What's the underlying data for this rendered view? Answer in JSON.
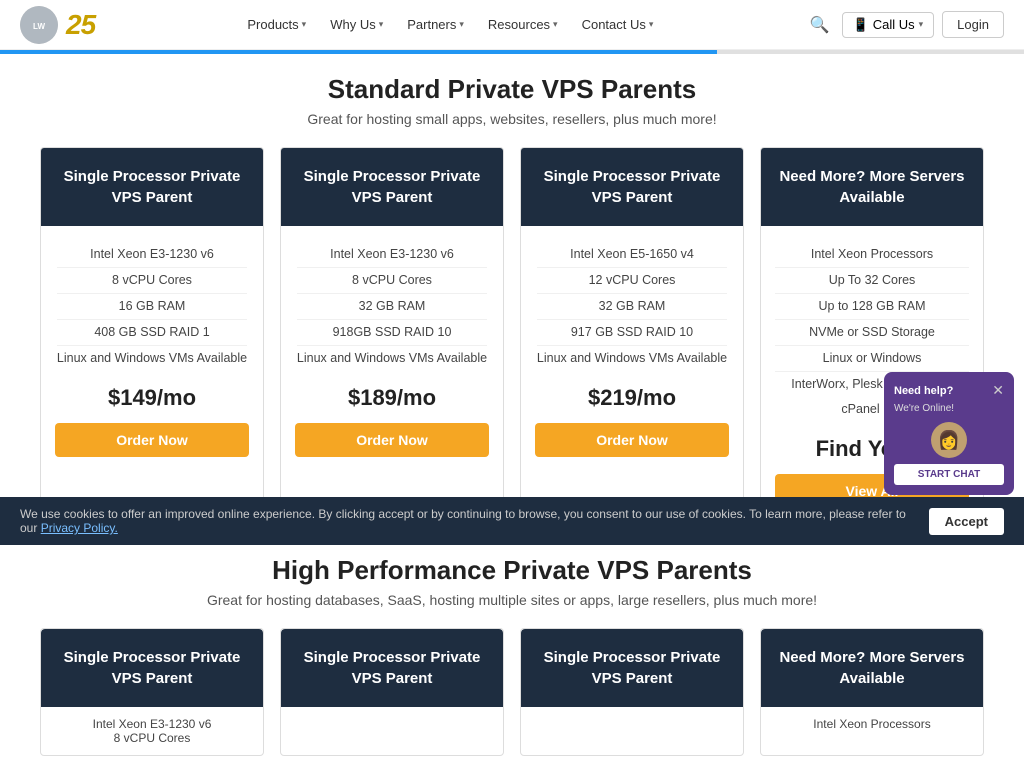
{
  "nav": {
    "logo_text": "25",
    "links": [
      {
        "label": "Products",
        "has_chevron": true
      },
      {
        "label": "Why Us",
        "has_chevron": true
      },
      {
        "label": "Partners",
        "has_chevron": true
      },
      {
        "label": "Resources",
        "has_chevron": true
      },
      {
        "label": "Contact Us",
        "has_chevron": true
      }
    ],
    "call_label": "Call Us",
    "login_label": "Login"
  },
  "standard_section": {
    "title": "Standard Private VPS Parents",
    "subtitle": "Great for hosting small apps, websites, resellers, plus much more!",
    "cards": [
      {
        "header": "Single Processor Private VPS Parent",
        "specs": [
          "Intel Xeon E3-1230 v6",
          "8 vCPU Cores",
          "16 GB RAM",
          "408 GB SSD RAID 1",
          "Linux and Windows VMs Available"
        ],
        "price": "$149/mo",
        "btn_label": "Order Now"
      },
      {
        "header": "Single Processor Private VPS Parent",
        "specs": [
          "Intel Xeon E3-1230 v6",
          "8 vCPU Cores",
          "32 GB RAM",
          "918GB SSD RAID 10",
          "Linux and Windows VMs Available"
        ],
        "price": "$189/mo",
        "btn_label": "Order Now"
      },
      {
        "header": "Single Processor Private VPS Parent",
        "specs": [
          "Intel Xeon E5-1650 v4",
          "12 vCPU Cores",
          "32 GB RAM",
          "917 GB SSD RAID 10",
          "Linux and Windows VMs Available"
        ],
        "price": "$219/mo",
        "btn_label": "Order Now"
      },
      {
        "header": "Need More? More Servers Available",
        "specs": [
          "Intel Xeon Processors",
          "Up To 32 Cores",
          "Up to 128 GB RAM",
          "NVMe or SSD Storage",
          "Linux or Windows",
          "InterWorx, Plesk Web Pro, or cPanel Pro"
        ],
        "price": "Find Yours",
        "btn_label": "View All",
        "is_custom": true
      }
    ]
  },
  "high_perf_section": {
    "title": "High Performance Private VPS Parents",
    "subtitle": "Great for hosting databases, SaaS, hosting multiple sites or apps, large resellers, plus much more!",
    "cards": [
      {
        "header": "Single Processor Private VPS Parent",
        "specs": [
          "Intel Xeon E3-1230 v6",
          "8 vCPU Cores"
        ]
      },
      {
        "header": "Single Processor Private VPS Parent",
        "specs": []
      },
      {
        "header": "Single Processor Private VPS Parent",
        "specs": []
      },
      {
        "header": "Need More? More Servers Available",
        "specs": [
          "Intel Xeon Processors"
        ]
      }
    ]
  },
  "cookie": {
    "text": "We use cookies to offer an improved online experience. By clicking accept or by continuing to browse, you consent to our use of cookies. To learn more, please refer to our",
    "link_text": "Privacy Policy.",
    "accept_label": "Accept"
  },
  "chat": {
    "title": "Need help?",
    "subtitle": "We're Online!",
    "btn_label": "START CHAT"
  }
}
